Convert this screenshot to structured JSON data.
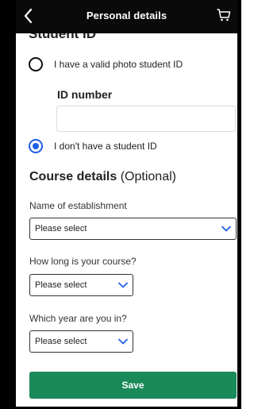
{
  "header": {
    "title": "Personal details",
    "back_icon": "chevron-left-icon",
    "cart_icon": "cart-icon"
  },
  "student_id": {
    "heading": "Student ID",
    "option_valid": "I have a valid photo student ID",
    "id_number_label": "ID number",
    "id_number_value": "",
    "option_none": "I don't have a student ID",
    "selected_option": "option_none"
  },
  "course": {
    "title": "Course details",
    "optional": "(Optional)",
    "establishment_label": "Name of establishment",
    "establishment_value": "Please select",
    "length_label": "How long is your course?",
    "length_value": "Please select",
    "year_label": "Which year are you in?",
    "year_value": "Please select"
  },
  "actions": {
    "save_label": "Save"
  },
  "colors": {
    "header_bg": "#0a0a0a",
    "radio_selected": "#1e5ee8",
    "save_button": "#1a8a5a"
  }
}
